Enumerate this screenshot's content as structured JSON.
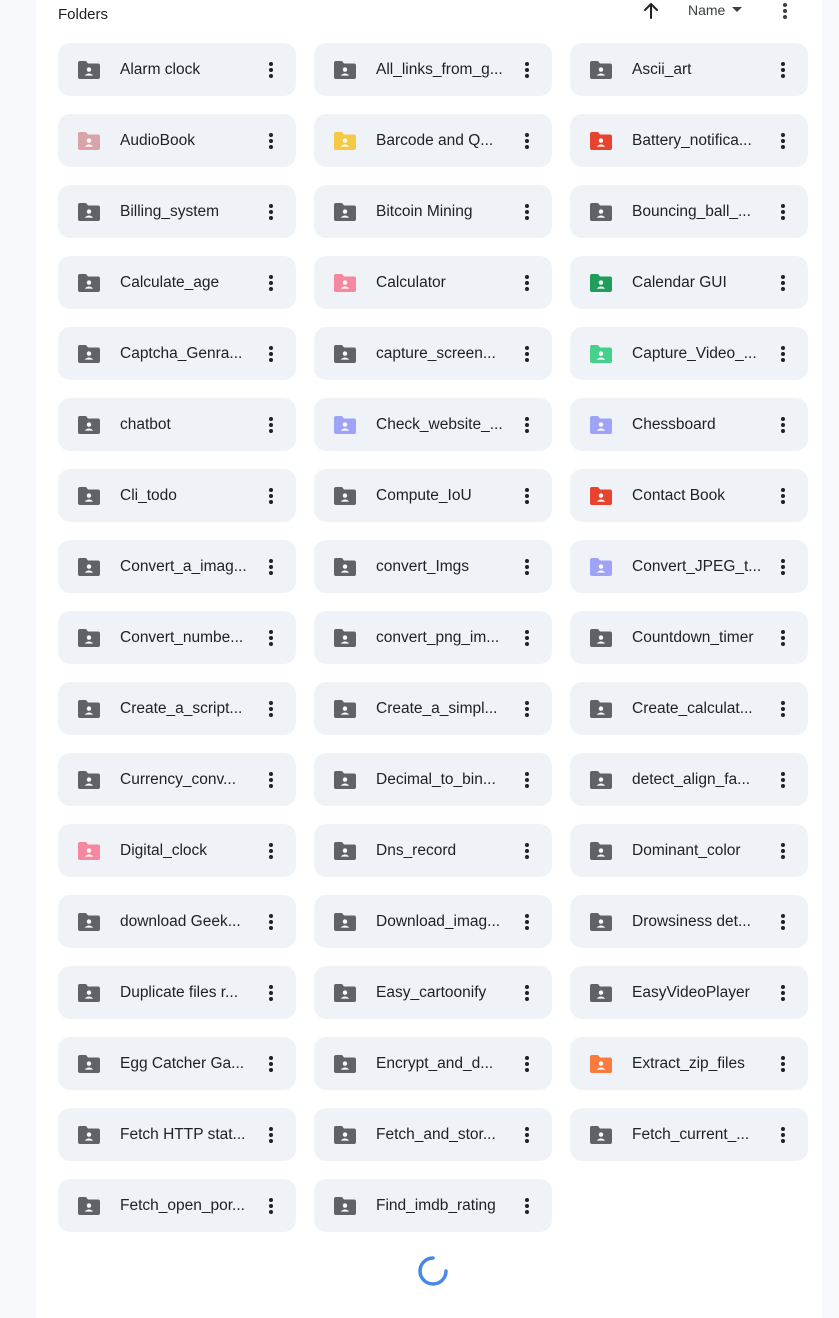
{
  "header": {
    "title": "Folders",
    "sort_label": "Name",
    "sort_arrow_icon": "arrow-up-icon",
    "more_icon": "more-vert-icon"
  },
  "colors": {
    "default": "#5f6368",
    "mauve": "#d9a3a8",
    "yellow": "#f6c945",
    "red": "#e8432e",
    "pink": "#f5879e",
    "green": "#1e9e5a",
    "mint": "#47d08b",
    "lavender": "#9fa3f7",
    "orange": "#f97b3d"
  },
  "folders": [
    {
      "name": "Alarm clock",
      "color": "default"
    },
    {
      "name": "All_links_from_g...",
      "color": "default"
    },
    {
      "name": "Ascii_art",
      "color": "default"
    },
    {
      "name": "AudioBook",
      "color": "mauve"
    },
    {
      "name": "Barcode and Q...",
      "color": "yellow"
    },
    {
      "name": "Battery_notifica...",
      "color": "red"
    },
    {
      "name": "Billing_system",
      "color": "default"
    },
    {
      "name": "Bitcoin Mining",
      "color": "default"
    },
    {
      "name": "Bouncing_ball_...",
      "color": "default"
    },
    {
      "name": "Calculate_age",
      "color": "default"
    },
    {
      "name": "Calculator",
      "color": "pink"
    },
    {
      "name": "Calendar GUI",
      "color": "green"
    },
    {
      "name": "Captcha_Genra...",
      "color": "default"
    },
    {
      "name": "capture_screen...",
      "color": "default"
    },
    {
      "name": "Capture_Video_...",
      "color": "mint"
    },
    {
      "name": "chatbot",
      "color": "default"
    },
    {
      "name": "Check_website_...",
      "color": "lavender"
    },
    {
      "name": "Chessboard",
      "color": "lavender"
    },
    {
      "name": "Cli_todo",
      "color": "default"
    },
    {
      "name": "Compute_IoU",
      "color": "default"
    },
    {
      "name": "Contact Book",
      "color": "red"
    },
    {
      "name": "Convert_a_imag...",
      "color": "default"
    },
    {
      "name": "convert_Imgs",
      "color": "default"
    },
    {
      "name": "Convert_JPEG_t...",
      "color": "lavender"
    },
    {
      "name": "Convert_numbe...",
      "color": "default"
    },
    {
      "name": "convert_png_im...",
      "color": "default"
    },
    {
      "name": "Countdown_timer",
      "color": "default"
    },
    {
      "name": "Create_a_script...",
      "color": "default"
    },
    {
      "name": "Create_a_simpl...",
      "color": "default"
    },
    {
      "name": "Create_calculat...",
      "color": "default"
    },
    {
      "name": "Currency_conv...",
      "color": "default"
    },
    {
      "name": "Decimal_to_bin...",
      "color": "default"
    },
    {
      "name": "detect_align_fa...",
      "color": "default"
    },
    {
      "name": "Digital_clock",
      "color": "pink"
    },
    {
      "name": "Dns_record",
      "color": "default"
    },
    {
      "name": "Dominant_color",
      "color": "default"
    },
    {
      "name": "download Geek...",
      "color": "default"
    },
    {
      "name": "Download_imag...",
      "color": "default"
    },
    {
      "name": "Drowsiness det...",
      "color": "default"
    },
    {
      "name": "Duplicate files r...",
      "color": "default"
    },
    {
      "name": "Easy_cartoonify",
      "color": "default"
    },
    {
      "name": "EasyVideoPlayer",
      "color": "default"
    },
    {
      "name": "Egg Catcher Ga...",
      "color": "default"
    },
    {
      "name": "Encrypt_and_d...",
      "color": "default"
    },
    {
      "name": "Extract_zip_files",
      "color": "orange"
    },
    {
      "name": "Fetch HTTP stat...",
      "color": "default"
    },
    {
      "name": "Fetch_and_stor...",
      "color": "default"
    },
    {
      "name": "Fetch_current_...",
      "color": "default"
    },
    {
      "name": "Fetch_open_por...",
      "color": "default"
    },
    {
      "name": "Find_imdb_rating",
      "color": "default"
    }
  ],
  "icons": {
    "folder": "shared-folder-icon",
    "more": "more-vert-icon",
    "loading": "loading-spinner-icon"
  }
}
